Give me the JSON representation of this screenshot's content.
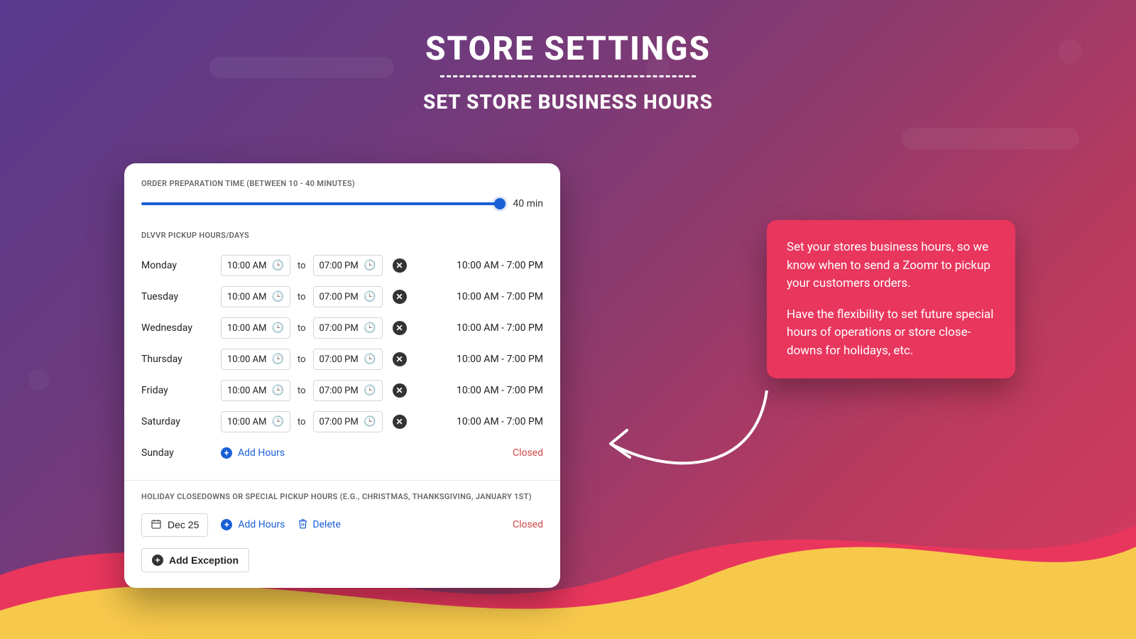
{
  "header": {
    "title": "STORE SETTINGS",
    "subtitle": "SET STORE BUSINESS HOURS"
  },
  "prep": {
    "label": "ORDER PREPARATION TIME (BETWEEN 10 - 40 MINUTES)",
    "value_label": "40 min"
  },
  "hours": {
    "label": "DLVVR PICKUP HOURS/DAYS",
    "to_label": "to",
    "days": [
      {
        "name": "Monday",
        "open": "10:00 AM",
        "close": "07:00 PM",
        "summary": "10:00 AM - 7:00 PM"
      },
      {
        "name": "Tuesday",
        "open": "10:00 AM",
        "close": "07:00 PM",
        "summary": "10:00 AM - 7:00 PM"
      },
      {
        "name": "Wednesday",
        "open": "10:00 AM",
        "close": "07:00 PM",
        "summary": "10:00 AM - 7:00 PM"
      },
      {
        "name": "Thursday",
        "open": "10:00 AM",
        "close": "07:00 PM",
        "summary": "10:00 AM - 7:00 PM"
      },
      {
        "name": "Friday",
        "open": "10:00 AM",
        "close": "07:00 PM",
        "summary": "10:00 AM - 7:00 PM"
      },
      {
        "name": "Saturday",
        "open": "10:00 AM",
        "close": "07:00 PM",
        "summary": "10:00 AM - 7:00 PM"
      }
    ],
    "closed_day": {
      "name": "Sunday",
      "add_label": "Add Hours",
      "summary": "Closed"
    }
  },
  "exceptions": {
    "label": "HOLIDAY CLOSEDOWNS OR SPECIAL PICKUP HOURS (E.G., CHRISTMAS, THANKSGIVING, JANUARY 1ST)",
    "date": "Dec 25",
    "add_label": "Add Hours",
    "delete_label": "Delete",
    "summary": "Closed",
    "add_exception_label": "Add Exception"
  },
  "callout": {
    "p1": "Set your stores business hours, so we know when to send a Zoomr to pickup your customers orders.",
    "p2": "Have the flexibility to set future special hours of operations or store close-downs for holidays, etc."
  }
}
